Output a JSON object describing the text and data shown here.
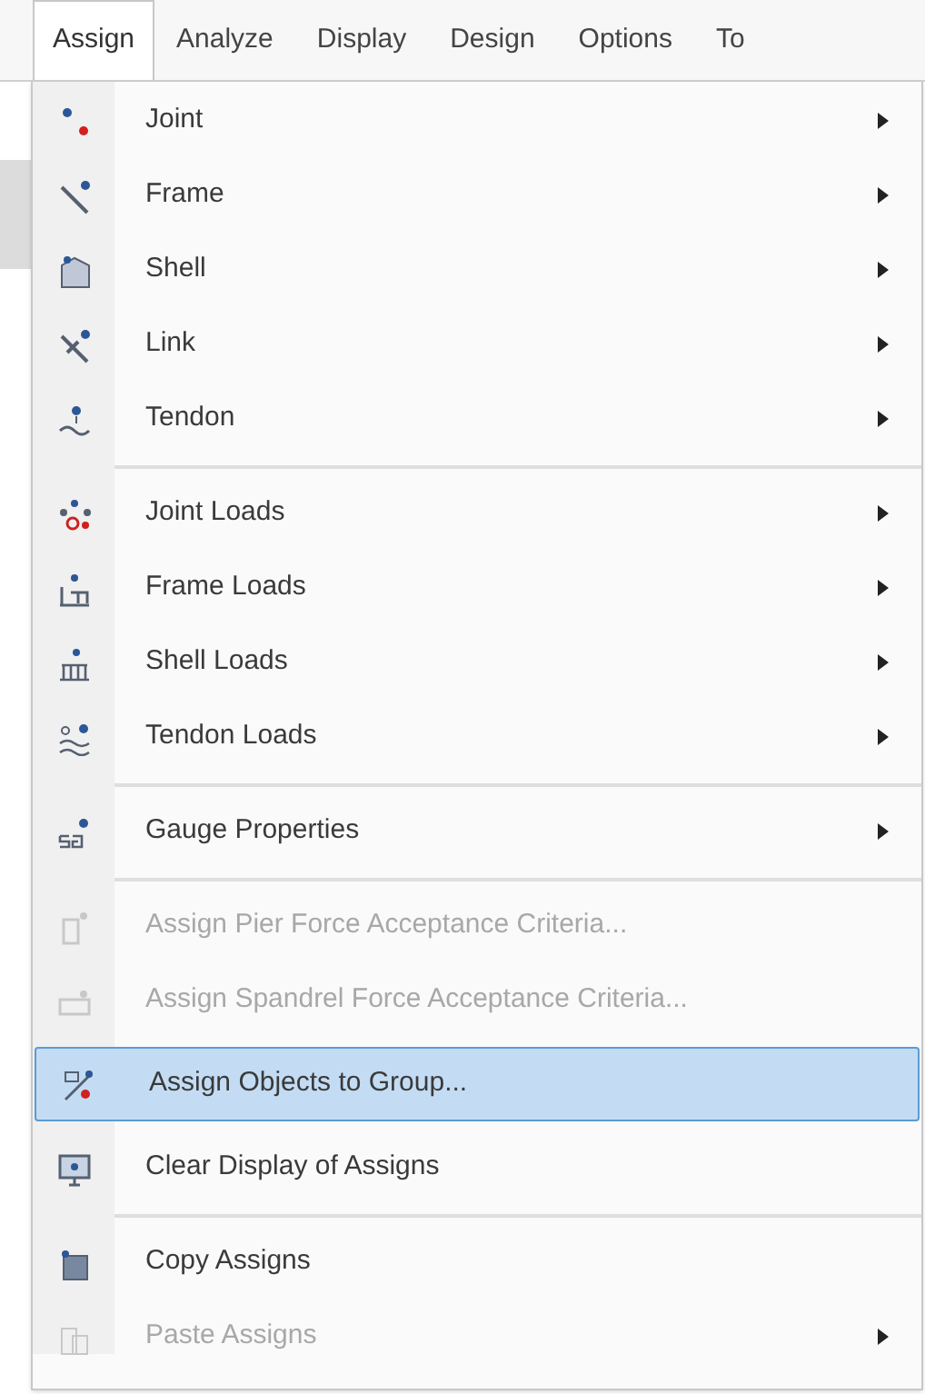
{
  "menu_bar": [
    {
      "label": "Assign",
      "selected": true
    },
    {
      "label": "Analyze",
      "selected": false
    },
    {
      "label": "Display",
      "selected": false
    },
    {
      "label": "Design",
      "selected": false
    },
    {
      "label": "Options",
      "selected": false
    },
    {
      "label": "To",
      "selected": false
    }
  ],
  "menu_groups": [
    [
      {
        "label": "Joint",
        "submenu": true,
        "disabled": false,
        "selected": false
      },
      {
        "label": "Frame",
        "submenu": true,
        "disabled": false,
        "selected": false
      },
      {
        "label": "Shell",
        "submenu": true,
        "disabled": false,
        "selected": false
      },
      {
        "label": "Link",
        "submenu": true,
        "disabled": false,
        "selected": false
      },
      {
        "label": "Tendon",
        "submenu": true,
        "disabled": false,
        "selected": false
      }
    ],
    [
      {
        "label": "Joint Loads",
        "submenu": true,
        "disabled": false,
        "selected": false
      },
      {
        "label": "Frame Loads",
        "submenu": true,
        "disabled": false,
        "selected": false
      },
      {
        "label": "Shell Loads",
        "submenu": true,
        "disabled": false,
        "selected": false
      },
      {
        "label": "Tendon Loads",
        "submenu": true,
        "disabled": false,
        "selected": false
      }
    ],
    [
      {
        "label": "Gauge Properties",
        "submenu": true,
        "disabled": false,
        "selected": false
      }
    ],
    [
      {
        "label": "Assign Pier Force Acceptance Criteria...",
        "submenu": false,
        "disabled": true,
        "selected": false
      },
      {
        "label": "Assign Spandrel Force Acceptance Criteria...",
        "submenu": false,
        "disabled": true,
        "selected": false
      },
      {
        "label": "Assign Objects to Group...",
        "submenu": false,
        "disabled": false,
        "selected": true
      },
      {
        "label": "Clear Display of Assigns",
        "submenu": false,
        "disabled": false,
        "selected": false
      }
    ],
    [
      {
        "label": "Copy Assigns",
        "submenu": false,
        "disabled": false,
        "selected": false
      },
      {
        "label": "Paste Assigns",
        "submenu": true,
        "disabled": true,
        "selected": false
      }
    ]
  ]
}
